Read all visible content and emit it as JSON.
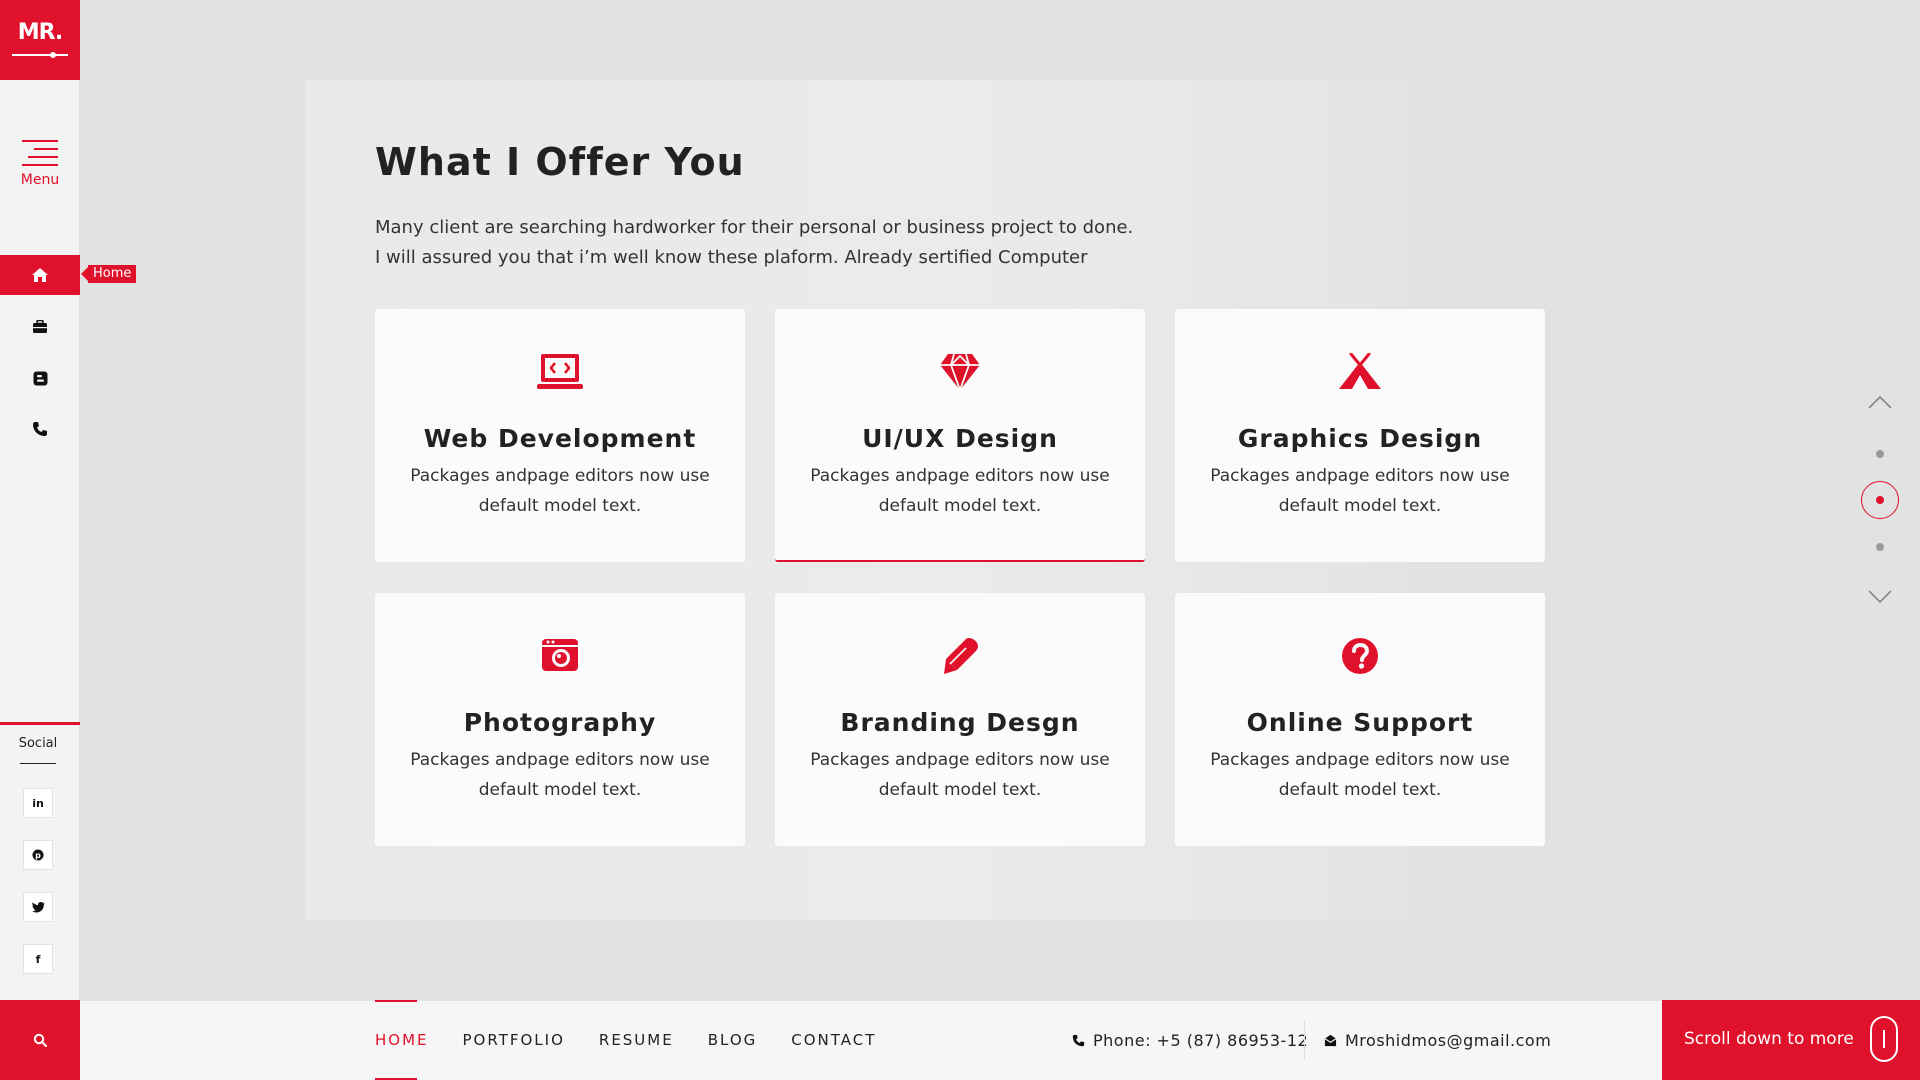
{
  "brand": {
    "logo_text": "MR.",
    "accent_color": "#e0112b"
  },
  "sidebar": {
    "menu_label": "Menu",
    "nav": [
      {
        "icon": "home-icon",
        "tooltip": "Home",
        "active": true
      },
      {
        "icon": "briefcase-icon",
        "active": false
      },
      {
        "icon": "blogger-icon",
        "active": false
      },
      {
        "icon": "phone-icon",
        "active": false
      }
    ],
    "social_label": "Social",
    "social": [
      {
        "icon": "linkedin-icon",
        "glyph": "in"
      },
      {
        "icon": "pinterest-icon",
        "glyph": "P"
      },
      {
        "icon": "twitter-icon",
        "glyph": "t"
      },
      {
        "icon": "facebook-icon",
        "glyph": "f"
      }
    ]
  },
  "main": {
    "title": "What I Offer You",
    "intro_line1": "Many client are searching hardworker for their personal or business project to done.",
    "intro_line2": "I will assured you that i’m well know these plaform. Already sertified Computer",
    "services": [
      {
        "icon": "laptop-code-icon",
        "title": "Web Development",
        "text": "Packages andpage editors now use default model text."
      },
      {
        "icon": "diamond-icon",
        "title": "UI/UX Design",
        "text": "Packages andpage editors now use default model text."
      },
      {
        "icon": "campground-icon",
        "title": "Graphics Design",
        "text": "Packages andpage editors now use default model text."
      },
      {
        "icon": "camera-icon",
        "title": "Photography",
        "text": "Packages andpage editors now use default model text."
      },
      {
        "icon": "pen-icon",
        "title": "Branding Desgn",
        "text": "Packages andpage editors now use default model text."
      },
      {
        "icon": "question-circle-icon",
        "title": "Online Support",
        "text": "Packages andpage editors now use default model text."
      }
    ],
    "active_service": "UI/UX Design"
  },
  "bottom_nav": {
    "links": [
      "HOME",
      "PORTFOLIO",
      "RESUME",
      "BLOG",
      "CONTACT"
    ],
    "active": "HOME"
  },
  "contact": {
    "phone": "Phone: +5 (87) 86953-12",
    "email": "Mroshidmos@gmail.com"
  },
  "scroll_cta": "Scroll down to more",
  "scroll_nav": {
    "dots": 3,
    "active_dot": 2
  }
}
